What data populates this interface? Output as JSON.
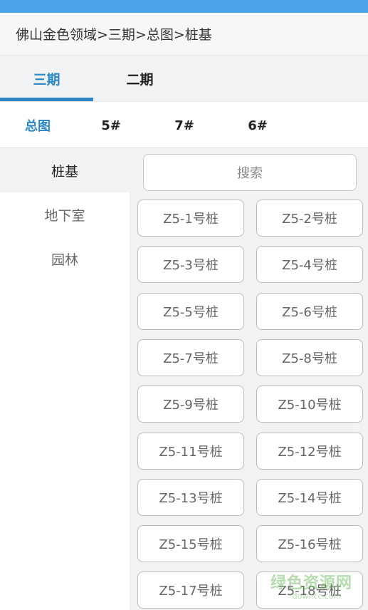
{
  "breadcrumb": "佛山金色领域>三期>总图>桩基",
  "phase_tabs": [
    {
      "label": "三期",
      "active": true
    },
    {
      "label": "二期",
      "active": false
    }
  ],
  "building_tabs": [
    {
      "label": "总图",
      "active": true
    },
    {
      "label": "5#",
      "active": false
    },
    {
      "label": "7#",
      "active": false
    },
    {
      "label": "6#",
      "active": false
    }
  ],
  "sidebar": {
    "items": [
      {
        "label": "桩基",
        "active": true
      },
      {
        "label": "地下室",
        "active": false
      },
      {
        "label": "园林",
        "active": false
      }
    ]
  },
  "search": {
    "placeholder": "搜索"
  },
  "piles": [
    "Z5-1号桩",
    "Z5-2号桩",
    "Z5-3号桩",
    "Z5-4号桩",
    "Z5-5号桩",
    "Z5-6号桩",
    "Z5-7号桩",
    "Z5-8号桩",
    "Z5-9号桩",
    "Z5-10号桩",
    "Z5-11号桩",
    "Z5-12号桩",
    "Z5-13号桩",
    "Z5-14号桩",
    "Z5-15号桩",
    "Z5-16号桩",
    "Z5-17号桩",
    "Z5-18号桩"
  ],
  "watermark": {
    "main": "绿色资源网",
    "sub": "downcc.com"
  },
  "colors": {
    "accent": "#2a86c4",
    "status_bar": "#4aa3e6"
  }
}
